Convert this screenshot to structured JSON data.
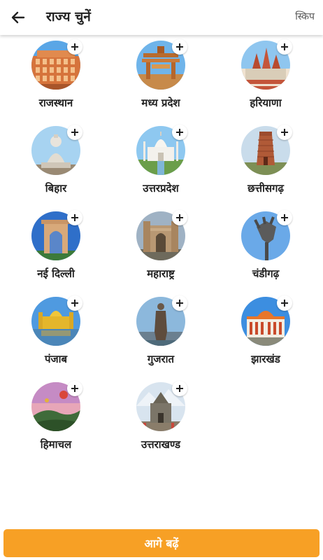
{
  "header": {
    "title": "राज्य चुनें",
    "skip_label": "स्किप",
    "back_icon": "arrow-left-icon"
  },
  "states": [
    {
      "label": "राजस्थान",
      "image": "hawa-mahal-image"
    },
    {
      "label": "मध्य प्रदेश",
      "image": "sanchi-stupa-image"
    },
    {
      "label": "हरियाणा",
      "image": "temple-image"
    },
    {
      "label": "बिहार",
      "image": "buddha-statue-image"
    },
    {
      "label": "उत्तरप्रदेश",
      "image": "taj-mahal-image"
    },
    {
      "label": "छत्तीसगढ़",
      "image": "brick-temple-image"
    },
    {
      "label": "नई दिल्ली",
      "image": "india-gate-image"
    },
    {
      "label": "महाराष्ट्र",
      "image": "gateway-of-india-image"
    },
    {
      "label": "चंडीगढ़",
      "image": "open-hand-monument-image"
    },
    {
      "label": "पंजाब",
      "image": "golden-temple-image"
    },
    {
      "label": "गुजरात",
      "image": "statue-of-unity-image"
    },
    {
      "label": "झारखंड",
      "image": "government-building-image"
    },
    {
      "label": "हिमाचल",
      "image": "hot-air-balloons-image"
    },
    {
      "label": "उत्तराखण्ड",
      "image": "kedarnath-temple-image"
    }
  ],
  "add_icon": "plus-icon",
  "footer": {
    "next_label": "आगे बढ़ें",
    "button_color": "#f7a025"
  }
}
